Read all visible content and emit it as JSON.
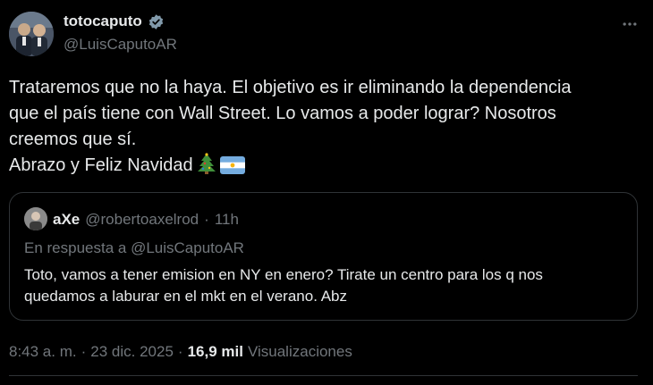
{
  "author": {
    "name": "totocaputo",
    "handle": "@LuisCaputoAR",
    "avatar_icon": "profile-photo",
    "verified_icon": "verified-badge-icon",
    "verified_color": "#829aab"
  },
  "tweet": {
    "lines": [
      "Trataremos que no la haya. El objetivo es ir eliminando la dependencia",
      "que el país tiene con Wall Street. Lo vamos a poder lograr? Nosotros",
      "creemos que sí.",
      "Abrazo y Feliz Navidad"
    ],
    "emojis": [
      "christmas-tree-icon",
      "argentina-flag-icon"
    ]
  },
  "quote": {
    "name": "aXe",
    "handle": "@robertoaxelrod",
    "separator": "·",
    "time": "11h",
    "reply_to": "En respuesta a @LuisCaputoAR",
    "lines": [
      "Toto, vamos a tener emision en NY en enero? Tirate un centro para los q nos",
      "quedamos a laburar en el mkt en el verano. Abz"
    ]
  },
  "meta": {
    "time": "8:43 a. m.",
    "sep1": "·",
    "date": "23 dic. 2025",
    "sep2": "·",
    "views_count": "16,9 mil",
    "views_label": "Visualizaciones"
  },
  "colors": {
    "background": "#000000",
    "text": "#e7e9ea",
    "muted": "#71767b",
    "border": "#2f3336"
  }
}
